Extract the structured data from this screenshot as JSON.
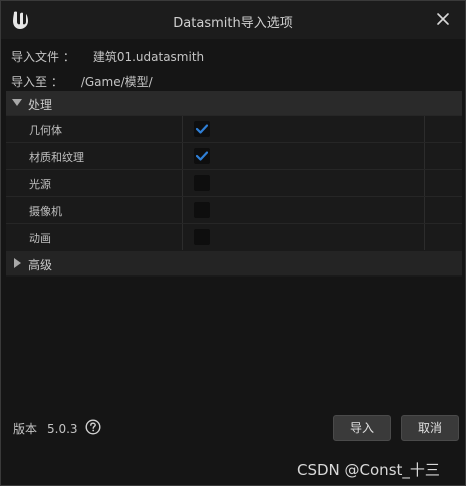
{
  "window": {
    "title": "Datasmith导入选项"
  },
  "info": {
    "import_file_label": "导入文件 ：",
    "import_file_value": "建筑01.udatasmith",
    "import_to_label": "导入至 ：",
    "import_to_value": "/Game/模型/"
  },
  "sections": {
    "processing": {
      "label": "处理",
      "rows": [
        {
          "label": "几何体",
          "checked": true
        },
        {
          "label": "材质和纹理",
          "checked": true
        },
        {
          "label": "光源",
          "checked": false
        },
        {
          "label": "摄像机",
          "checked": false
        },
        {
          "label": "动画",
          "checked": false
        }
      ]
    },
    "advanced": {
      "label": "高级"
    }
  },
  "footer": {
    "version_label": "版本",
    "version_value": "5.0.3",
    "import_button": "导入",
    "cancel_button": "取消"
  },
  "watermark": "CSDN @Const_十三",
  "colors": {
    "accent_check": "#2f7fd6",
    "background": "#151515",
    "section_header": "#2a2a2a"
  },
  "icons": {
    "logo": "unreal-engine-logo-icon",
    "close": "close-icon",
    "help": "help-icon",
    "expand": "triangle-down-icon",
    "collapse": "triangle-right-icon",
    "check": "checkmark-icon"
  }
}
